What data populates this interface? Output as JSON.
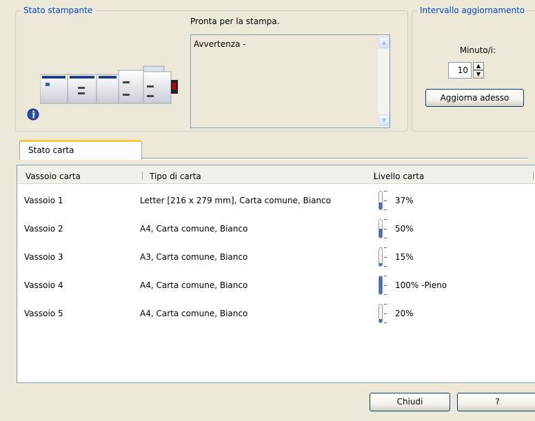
{
  "status_group": {
    "title": "Stato stampante",
    "ready_text": "Pronta per la stampa.",
    "warning_text": "Avvertenza -",
    "printer_image": "printer-system-image",
    "info_icon": "info-icon"
  },
  "interval_group": {
    "title": "Intervallo aggiornamento",
    "minutes_label": "Minuto/i:",
    "minutes_value": "10",
    "refresh_button": "Aggiorna adesso"
  },
  "tabs": [
    {
      "label": "Stato carta",
      "active": true
    }
  ],
  "table": {
    "columns": [
      "Vassoio carta",
      "Tipo di carta",
      "Livello carta"
    ],
    "rows": [
      {
        "tray": "Vassoio 1",
        "paper": "Letter [216 x 279 mm], Carta comune, Bianco",
        "level": 0.37,
        "level_text": "37%"
      },
      {
        "tray": "Vassoio 2",
        "paper": "A4, Carta comune, Bianco",
        "level": 0.5,
        "level_text": "50%"
      },
      {
        "tray": "Vassoio 3",
        "paper": "A3, Carta comune, Bianco",
        "level": 0.15,
        "level_text": "15%"
      },
      {
        "tray": "Vassoio 4",
        "paper": "A4, Carta comune, Bianco",
        "level": 1.0,
        "level_text": "100% -Pieno"
      },
      {
        "tray": "Vassoio 5",
        "paper": "A4, Carta comune, Bianco",
        "level": 0.2,
        "level_text": "20%"
      }
    ]
  },
  "buttons": {
    "close": "Chiudi",
    "help": "?"
  },
  "colors": {
    "accent": "#0046D5",
    "tab_highlight": "#FFC83C",
    "gauge_fill": "#2C4FA8"
  }
}
